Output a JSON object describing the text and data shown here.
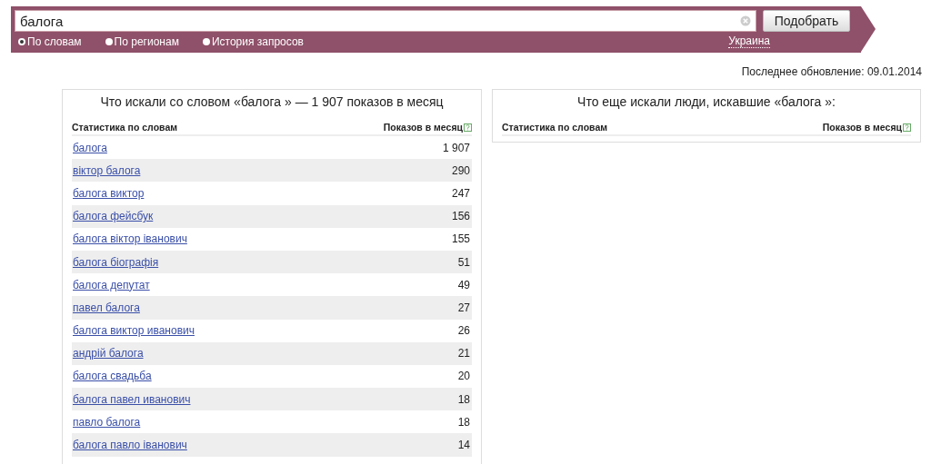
{
  "search": {
    "value": "балога",
    "button": "Подобрать",
    "modes": [
      {
        "label": "По словам",
        "selected": true
      },
      {
        "label": "По регионам",
        "selected": false
      },
      {
        "label": "История запросов",
        "selected": false
      }
    ],
    "region": "Украина"
  },
  "last_update": "Последнее обновление: 09.01.2014",
  "panels": [
    {
      "title": "Что искали со словом «балога » — 1 907 показов в месяц",
      "columns": [
        "Статистика по словам",
        "Показов в месяц"
      ],
      "rows": [
        {
          "phrase": "балога",
          "count": "1 907"
        },
        {
          "phrase": "віктор балога",
          "count": "290"
        },
        {
          "phrase": "балога виктор",
          "count": "247"
        },
        {
          "phrase": "балога фейсбук",
          "count": "156"
        },
        {
          "phrase": "балога віктор іванович",
          "count": "155"
        },
        {
          "phrase": "балога біографія",
          "count": "51"
        },
        {
          "phrase": "балога депутат",
          "count": "49"
        },
        {
          "phrase": "павел балога",
          "count": "27"
        },
        {
          "phrase": "балога виктор иванович",
          "count": "26"
        },
        {
          "phrase": "андрій балога",
          "count": "21"
        },
        {
          "phrase": "балога свадьба",
          "count": "20"
        },
        {
          "phrase": "балога павел иванович",
          "count": "18"
        },
        {
          "phrase": "павло балога",
          "count": "18"
        },
        {
          "phrase": "балога павло іванович",
          "count": "14"
        }
      ]
    },
    {
      "title": "Что еще искали люди, искавшие «балога »:",
      "columns": [
        "Статистика по словам",
        "Показов в месяц"
      ]
    }
  ]
}
